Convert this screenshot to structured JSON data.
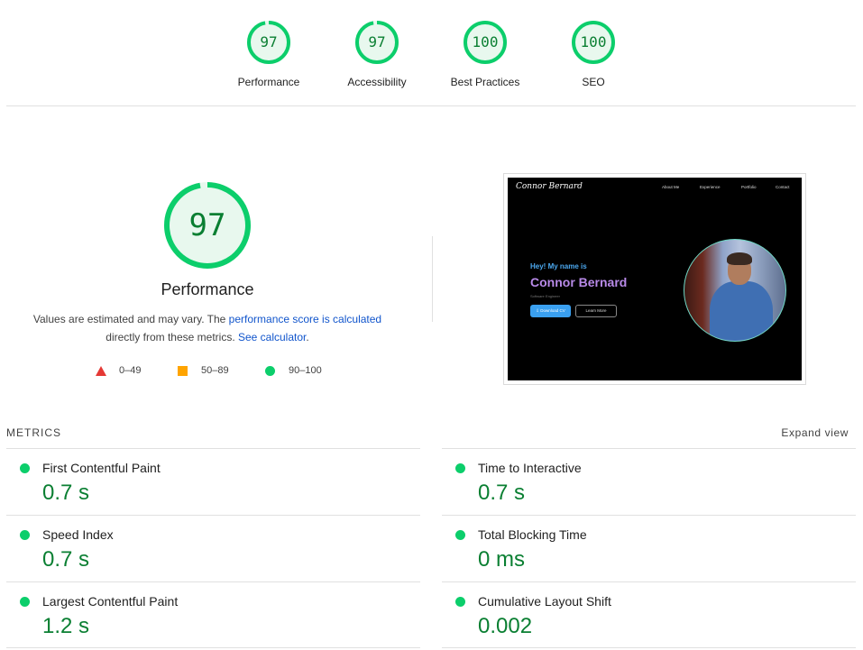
{
  "colors": {
    "pass": "#0cce6b",
    "pass_text": "#0a7f32",
    "average": "#ffa400",
    "fail": "#e53935",
    "link": "#1155cc"
  },
  "categories": [
    {
      "score": "97",
      "label": "Performance"
    },
    {
      "score": "97",
      "label": "Accessibility"
    },
    {
      "score": "100",
      "label": "Best Practices"
    },
    {
      "score": "100",
      "label": "SEO"
    }
  ],
  "performance": {
    "score": "97",
    "title": "Performance",
    "desc_prefix": "Values are estimated and may vary. The ",
    "desc_link1": "performance score is calculated",
    "desc_middle": "directly from these metrics. ",
    "desc_link2": "See calculator",
    "desc_suffix": "."
  },
  "legend": [
    {
      "icon": "fail-triangle-icon",
      "range": "0–49"
    },
    {
      "icon": "average-square-icon",
      "range": "50–89"
    },
    {
      "icon": "pass-circle-icon",
      "range": "90–100"
    }
  ],
  "screenshot": {
    "logo_text": "Connor Bernard",
    "nav": [
      "About Me",
      "Experience",
      "Portfolio",
      "Contact"
    ],
    "greeting": "Hey! My name is",
    "name": "Connor Bernard",
    "role": "Software Engineer",
    "button_primary": "⇩ Download CV",
    "button_secondary": "Learn More"
  },
  "metrics": {
    "title": "METRICS",
    "expand_label": "Expand view",
    "left": [
      {
        "label": "First Contentful Paint",
        "value": "0.7 s"
      },
      {
        "label": "Speed Index",
        "value": "0.7 s"
      },
      {
        "label": "Largest Contentful Paint",
        "value": "1.2 s"
      }
    ],
    "right": [
      {
        "label": "Time to Interactive",
        "value": "0.7 s"
      },
      {
        "label": "Total Blocking Time",
        "value": "0 ms"
      },
      {
        "label": "Cumulative Layout Shift",
        "value": "0.002"
      }
    ]
  }
}
